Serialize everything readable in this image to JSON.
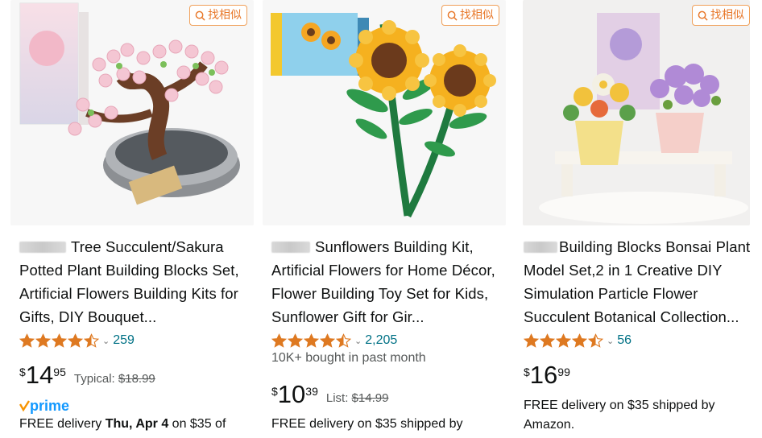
{
  "similar_label": "找相似",
  "colors": {
    "star": "#de7921",
    "link": "#007185",
    "prime_blue": "#1399ff",
    "similar_orange": "#e8782a"
  },
  "products": [
    {
      "title": "Tree Succulent/Sakura Potted Plant Building Blocks Set, Artificial Flowers Building Kits for Gifts, DIY Bouquet...",
      "rating_stars": 4.5,
      "review_count": "259",
      "bought": "",
      "price_symbol": "$",
      "price_whole": "14",
      "price_fraction": "95",
      "list_label": "Typical:",
      "list_price": "$18.99",
      "prime": true,
      "prime_label": "prime",
      "delivery_prefix": "FREE delivery ",
      "delivery_date": "Thu, Apr 4",
      "delivery_suffix": " on $35 of"
    },
    {
      "title": "Sunflowers Building Kit, Artificial Flowers for Home Décor, Flower Building Toy Set for Kids, Sunflower Gift for Gir...",
      "rating_stars": 4.5,
      "review_count": "2,205",
      "bought": "10K+ bought in past month",
      "price_symbol": "$",
      "price_whole": "10",
      "price_fraction": "39",
      "list_label": "List:",
      "list_price": "$14.99",
      "prime": false,
      "delivery_text": "FREE delivery on $35 shipped by"
    },
    {
      "title": "Building Blocks Bonsai Plant Model Set,2 in 1 Creative DIY Simulation Particle Flower Succulent Botanical Collection...",
      "rating_stars": 4.5,
      "review_count": "56",
      "bought": "",
      "price_symbol": "$",
      "price_whole": "16",
      "price_fraction": "99",
      "list_label": "",
      "list_price": "",
      "prime": false,
      "delivery_text": "FREE delivery on $35 shipped by Amazon."
    }
  ]
}
